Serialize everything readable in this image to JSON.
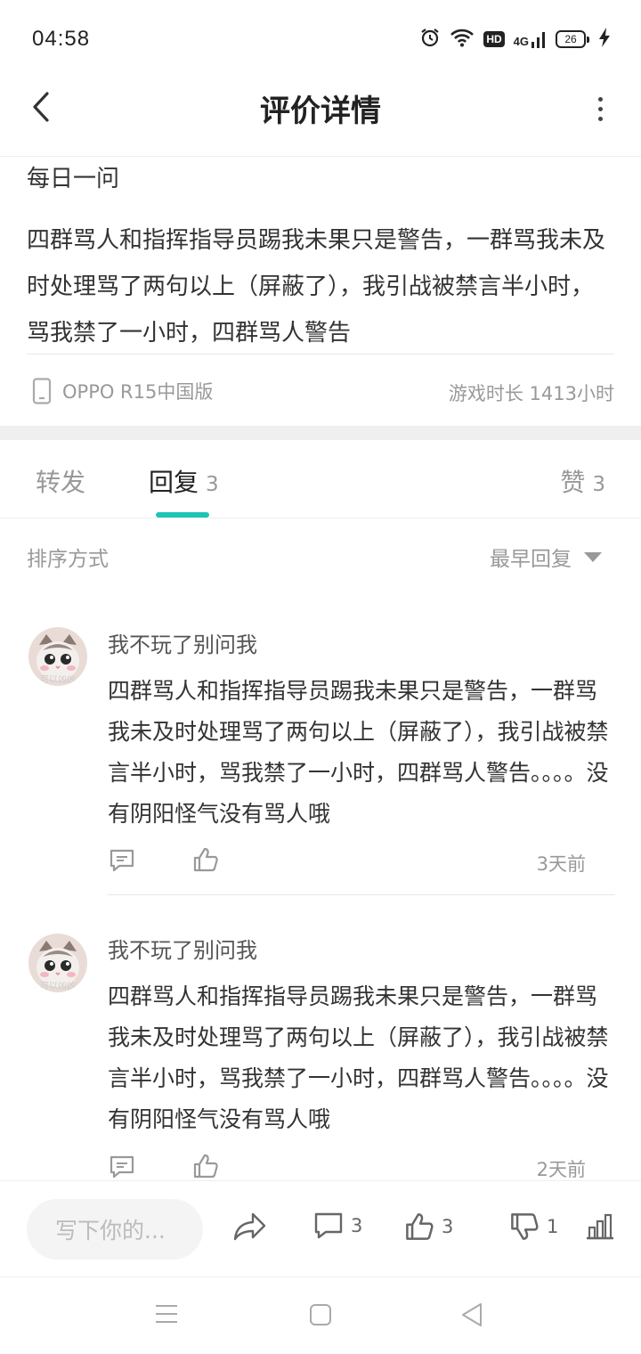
{
  "status_bar": {
    "time": "04:58",
    "hd": "HD",
    "network": "4G",
    "battery": "26"
  },
  "header": {
    "title": "评价详情"
  },
  "post": {
    "heading": "每日一问",
    "body": "四群骂人和指挥指导员踢我未果只是警告，一群骂我未及时处理骂了两句以上（屏蔽了），我引战被禁言半小时，骂我禁了一小时，四群骂人警告",
    "device": "OPPO R15中国版",
    "playtime": "游戏时长 1413小时"
  },
  "tabs": {
    "forward": {
      "label": "转发"
    },
    "reply": {
      "label": "回复",
      "count": "3"
    },
    "like": {
      "label": "赞",
      "count": "3"
    },
    "accent": "#1ec4b4"
  },
  "sort": {
    "label": "排序方式",
    "selected": "最早回复"
  },
  "replies": [
    {
      "username": "我不玩了别问我",
      "avatar_text": "可以凶凶",
      "body": "四群骂人和指挥指导员踢我未果只是警告，一群骂我未及时处理骂了两句以上（屏蔽了），我引战被禁言半小时，骂我禁了一小时，四群骂人警告。。。。没有阴阳怪气没有骂人哦",
      "time": "3天前"
    },
    {
      "username": "我不玩了别问我",
      "avatar_text": "可以凶凶",
      "body": "四群骂人和指挥指导员踢我未果只是警告，一群骂我未及时处理骂了两句以上（屏蔽了），我引战被禁言半小时，骂我禁了一小时，四群骂人警告。。。。没有阴阳怪气没有骂人哦",
      "time": "2天前"
    }
  ],
  "bottom_bar": {
    "compose_placeholder": "写下你的...",
    "comment_count": "3",
    "like_count": "3",
    "dislike_count": "1"
  },
  "icons": [
    "back-icon",
    "more-icon",
    "alarm-icon",
    "wifi-icon",
    "signal-icon",
    "battery-icon",
    "charging-icon",
    "phone-icon",
    "comment-icon",
    "thumbs-up-icon",
    "share-icon",
    "thumbs-down-icon",
    "stats-icon",
    "menu-icon",
    "home-icon",
    "back-nav-icon"
  ]
}
